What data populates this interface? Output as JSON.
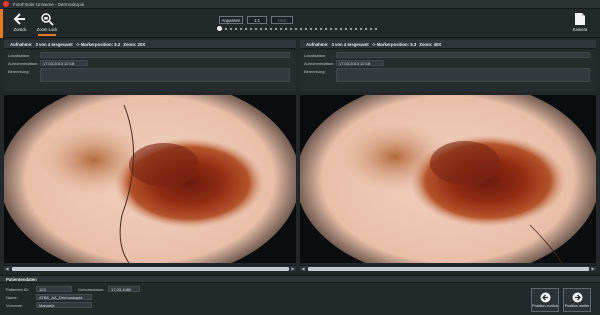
{
  "window": {
    "title": "FotoFinder Universe - Dermoskopie"
  },
  "toolbar": {
    "back_label": "Zurück",
    "zoom_lock_label": "Zoom Lock",
    "camera_label": "Kamera",
    "anpassen_label": "Anpassen",
    "ratio_label": "1:1",
    "disabled_label": "Next",
    "slider_value": 0.0
  },
  "left_pane": {
    "header": {
      "aufnahme": "Aufnahme:",
      "count": "3 von 4 Insgesamt",
      "marker": "-> Markerposition: 5.2",
      "zoom": "Zoom: 20X"
    },
    "lokalisation_label": "Lokalisation:",
    "datum_label": "Aufnahmedatum:",
    "datum_value": "17.03.2013 12:18",
    "bemerkung_label": "Bemerkung:"
  },
  "right_pane": {
    "header": {
      "aufnahme": "Aufnahme:",
      "count": "4 von 4 Insgesamt",
      "marker": "-> Markerposition: 5.3",
      "zoom": "Zoom: 40X"
    },
    "lokalisation_label": "Lokalisation:",
    "datum_label": "Aufnahmedatum:",
    "datum_value": "17.03.2013 12:18",
    "bemerkung_label": "Bemerkung:"
  },
  "patient": {
    "header": "Patientendaten",
    "id_label": "Patienten ID:",
    "id_value": "123",
    "geb_label": "Geburtsdatum:",
    "geb_value": "17.03.1980",
    "name_label": "Name:",
    "name_value": "ATBK_AA_Dermoskopie",
    "vorname_label": "Vorname:",
    "vorname_value": "Manuela"
  },
  "nav": {
    "prev_label": "Position zurück",
    "next_label": "Position weiter"
  },
  "colors": {
    "accent": "#e87a1c",
    "logo": "#e8352a"
  }
}
